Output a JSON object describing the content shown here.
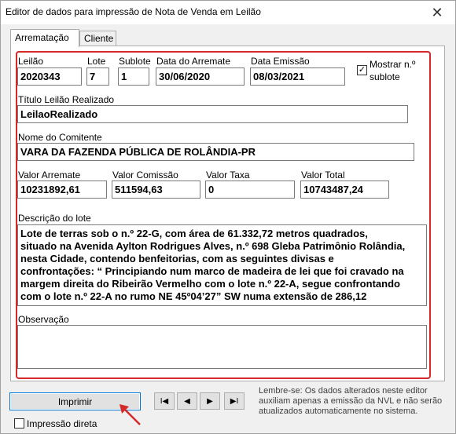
{
  "window": {
    "title": "Editor de dados para impressão de Nota de Venda em Leilão",
    "close_glyph": "✕"
  },
  "tabs": [
    {
      "label": "Arrematação",
      "active": true
    },
    {
      "label": "Cliente",
      "active": false
    }
  ],
  "form": {
    "leilao": {
      "label": "Leilão",
      "value": "2020343"
    },
    "lote": {
      "label": "Lote",
      "value": "7"
    },
    "sublote": {
      "label": "Sublote",
      "value": "1"
    },
    "data_arremate": {
      "label": "Data do Arremate",
      "value": "30/06/2020"
    },
    "data_emissao": {
      "label": "Data Emissão",
      "value": "08/03/2021"
    },
    "mostrar_sublote": {
      "label_line1": "Mostrar n.º",
      "label_line2": "sublote",
      "checked": true,
      "check_glyph": "✓"
    },
    "titulo": {
      "label": "Título Leilão Realizado",
      "value": "LeilaoRealizado"
    },
    "comitente": {
      "label": "Nome do Comitente",
      "value": "VARA DA FAZENDA PÚBLICA DE ROLÂNDIA-PR"
    },
    "valor_arremate": {
      "label": "Valor Arremate",
      "value": "10231892,61"
    },
    "valor_comissao": {
      "label": "Valor Comissão",
      "value": "511594,63"
    },
    "valor_taxa": {
      "label": "Valor Taxa",
      "value": "0"
    },
    "valor_total": {
      "label": "Valor Total",
      "value": "10743487,24"
    },
    "descricao": {
      "label": "Descrição do lote",
      "lines": [
        "Lote de terras sob o n.º 22-G, com área de 61.332,72 metros quadrados,",
        "situado na Avenida Aylton Rodrigues Alves, n.º 698 Gleba Patrimônio Rolândia,",
        "nesta Cidade, contendo benfeitorias, com as seguintes divisas e",
        "confrontações: “ Principiando num marco de madeira de lei que foi cravado na",
        "margem direita do Ribeirão Vermelho com o lote n.º 22-A, segue confrontando",
        "com o lote n.º 22-A no rumo NE 45º04’27” SW numa extensão de 286,12"
      ]
    },
    "observacao": {
      "label": "Observação",
      "value": ""
    }
  },
  "footer": {
    "print_label": "Imprimir",
    "direct_print_label": "Impressão direta",
    "direct_print_checked": false,
    "nav": [
      {
        "name": "first-record-button",
        "glyph": "I◀"
      },
      {
        "name": "prev-record-button",
        "glyph": "◀"
      },
      {
        "name": "next-record-button",
        "glyph": "▶"
      },
      {
        "name": "last-record-button",
        "glyph": "▶I"
      }
    ],
    "hint": "Lembre-se: Os dados alterados neste editor auxiliam apenas a emissão da NVL e não serão atualizados automaticamente no sistema."
  },
  "colors": {
    "highlight_frame": "#d62828",
    "accent": "#0078d7"
  }
}
